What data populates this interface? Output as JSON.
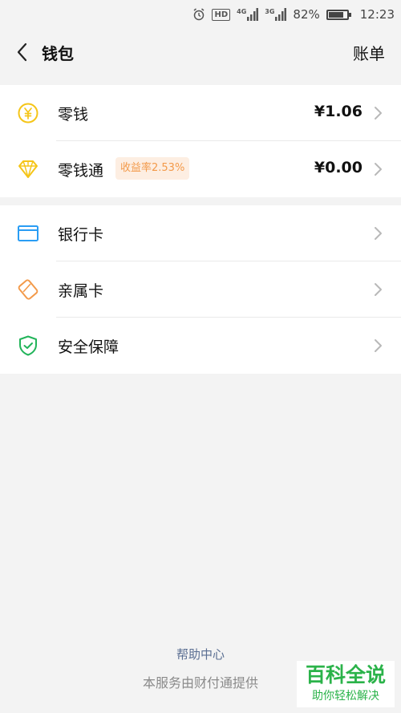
{
  "status_bar": {
    "hd": "HD",
    "net1": "4G",
    "net2": "3G",
    "battery_text": "82%",
    "battery_level": 0.82,
    "time": "12:23"
  },
  "header": {
    "title": "钱包",
    "bill": "账单"
  },
  "wallet": {
    "change": {
      "label": "零钱",
      "value": "¥1.06",
      "icon": "yuan-coin-icon",
      "color": "#f5c518"
    },
    "lqt": {
      "label": "零钱通",
      "badge": "收益率2.53%",
      "value": "¥0.00",
      "icon": "diamond-icon",
      "color": "#f5c518"
    }
  },
  "services": {
    "bankcard": {
      "label": "银行卡",
      "icon": "bank-card-icon",
      "color": "#2a9df4"
    },
    "family": {
      "label": "亲属卡",
      "icon": "family-card-icon",
      "color": "#f39a4a"
    },
    "security": {
      "label": "安全保障",
      "icon": "shield-check-icon",
      "color": "#22b45a"
    }
  },
  "footer": {
    "help": "帮助中心",
    "provider": "本服务由财付通提供"
  },
  "watermark": {
    "main": "百科全说",
    "sub": "助你轻松解决"
  }
}
